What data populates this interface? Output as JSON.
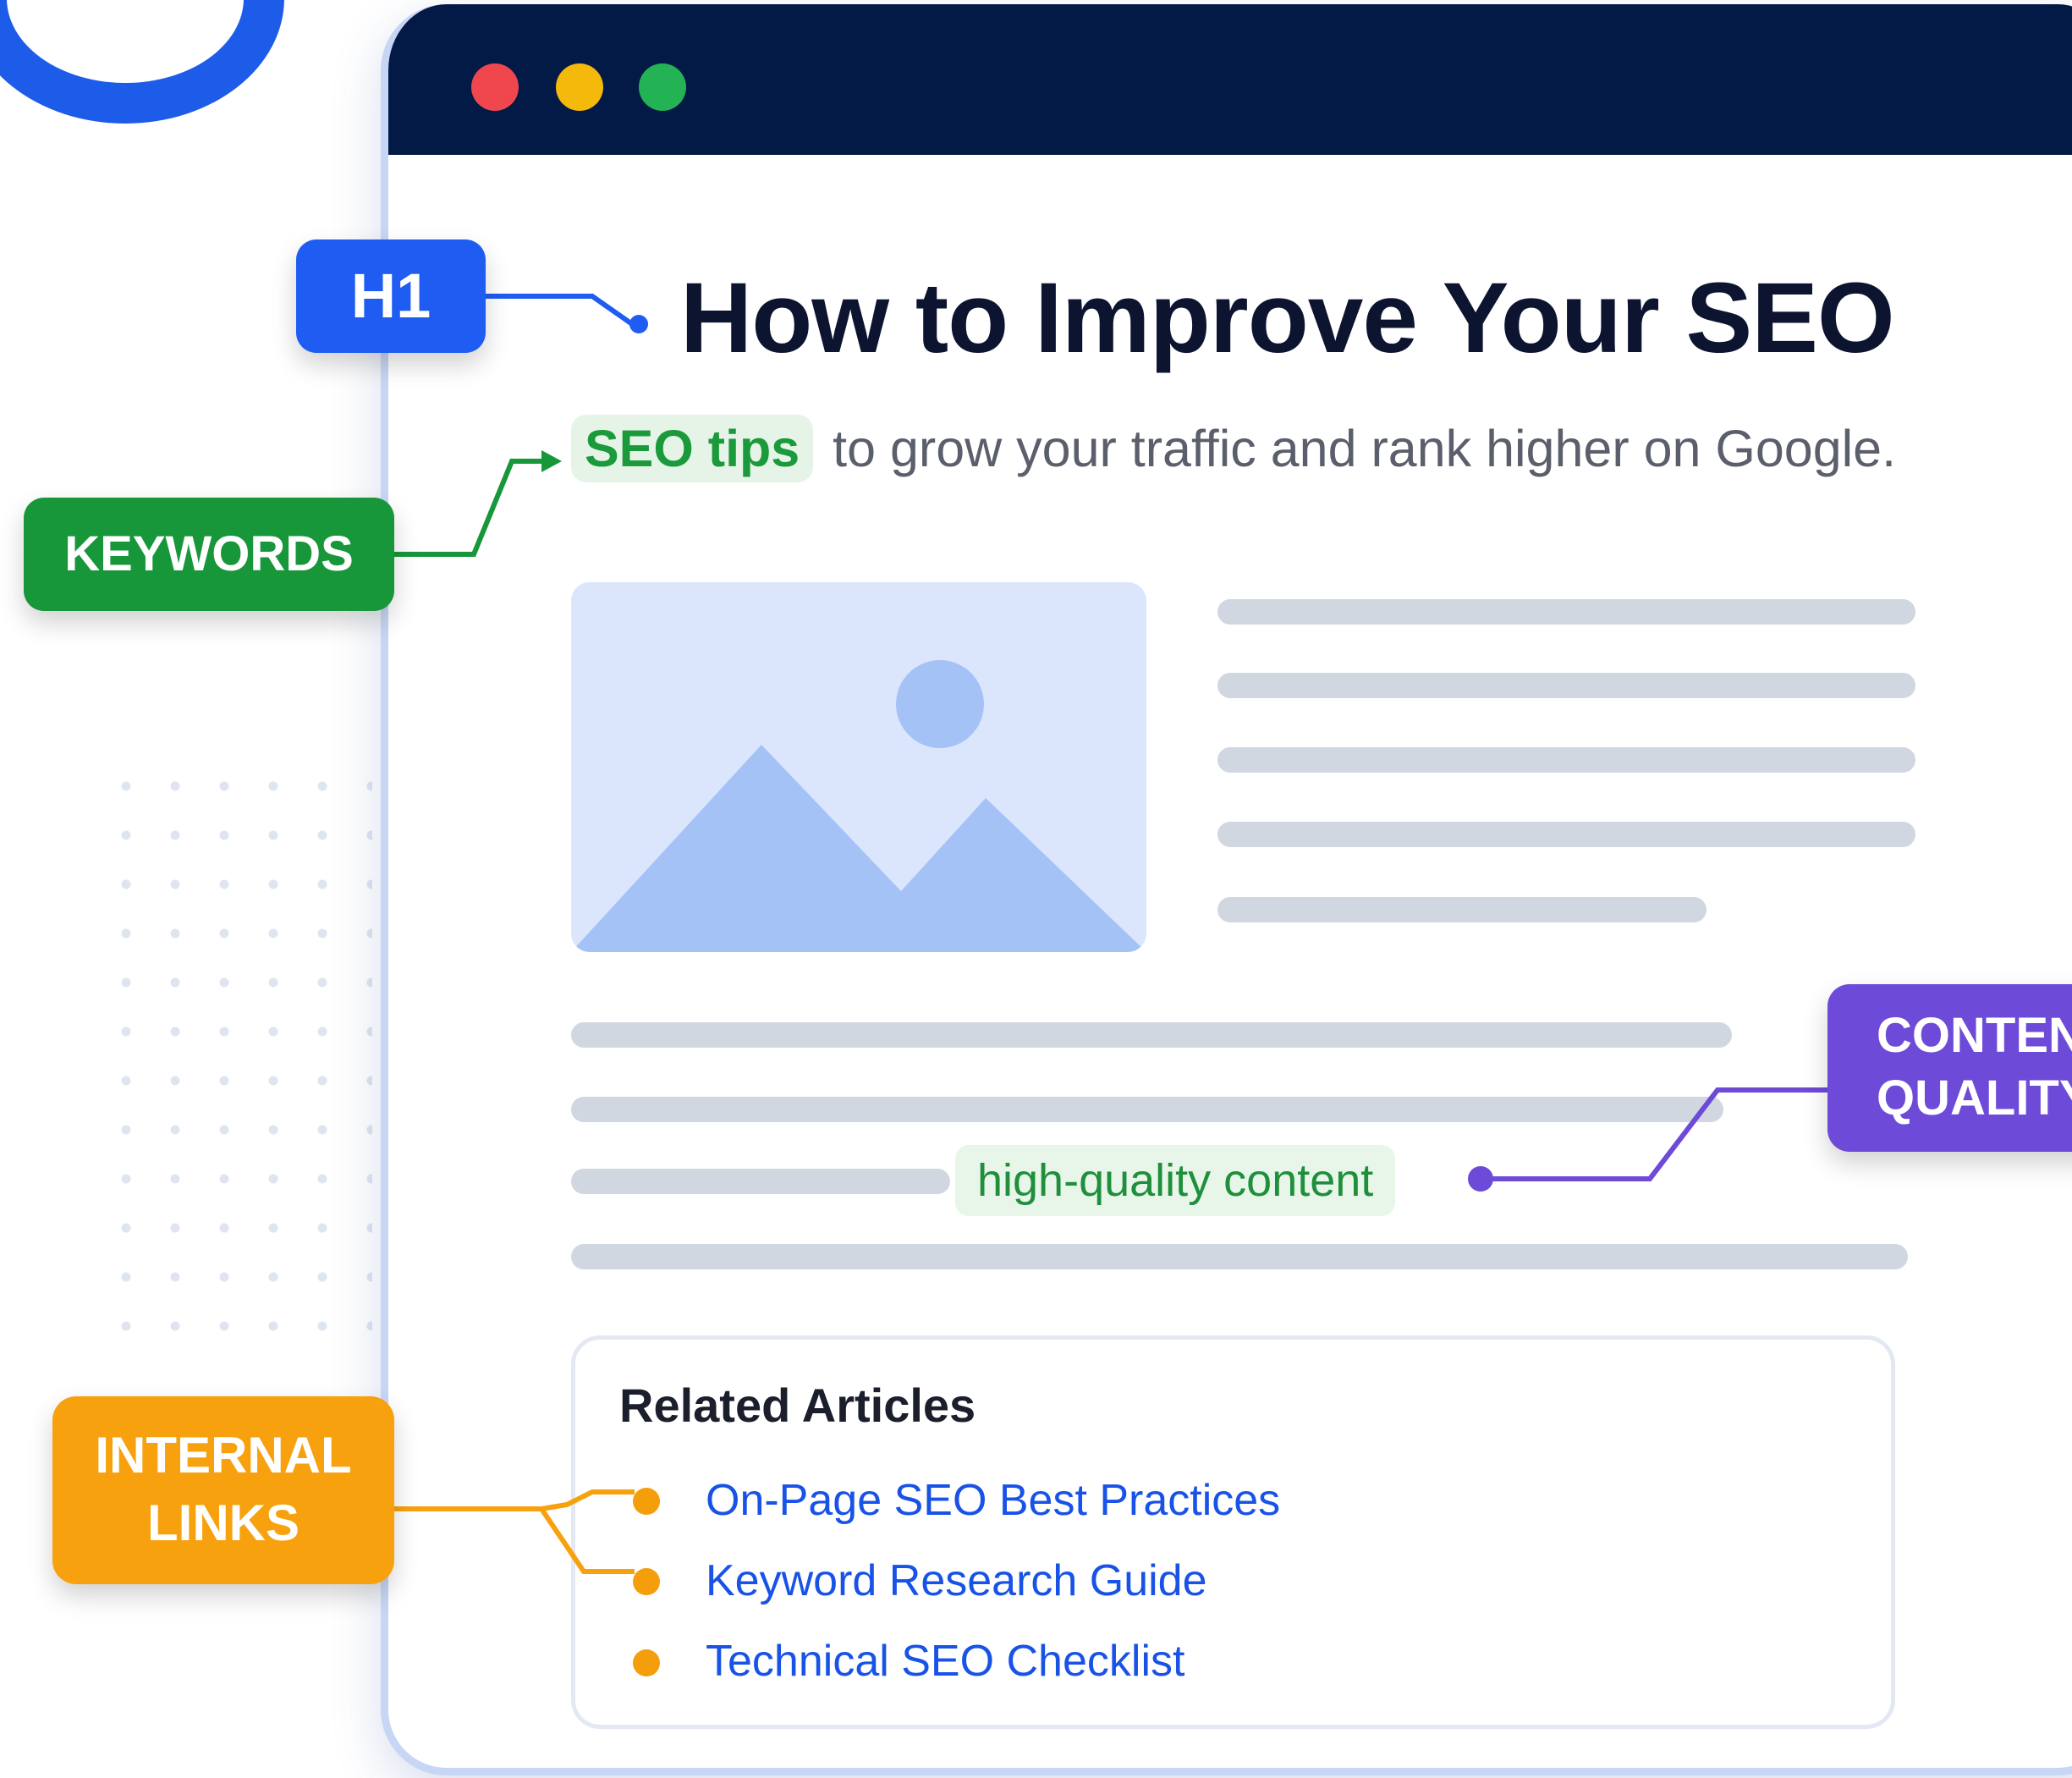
{
  "article": {
    "title": "How to Improve Your SEO",
    "subtitle_keyword": "SEO tips",
    "subtitle_rest": "to grow your traffic and rank higher on Google.",
    "highlight_phrase": "high-quality content"
  },
  "related_articles": {
    "title": "Related Articles",
    "items": [
      {
        "label": "On-Page SEO Best Practices"
      },
      {
        "label": "Keyword Research Guide"
      },
      {
        "label": "Technical SEO Checklist"
      }
    ]
  },
  "badges": {
    "h1": "H1",
    "keywords": "KEYWORDS",
    "internal_links_line1": "INTERNAL",
    "internal_links_line2": "LINKS",
    "content_quality_line1": "CONTENT",
    "content_quality_line2": "QUALITY"
  },
  "colors": {
    "titlebar": "#041a46",
    "h1_badge": "#1f5cf2",
    "keywords_badge": "#18963a",
    "internal_links_badge": "#f7a10f",
    "content_quality_badge": "#6d4ad8",
    "link_text": "#1852e6",
    "traffic_red": "#f0474f",
    "traffic_yellow": "#f5b90c",
    "traffic_green": "#23b254"
  }
}
